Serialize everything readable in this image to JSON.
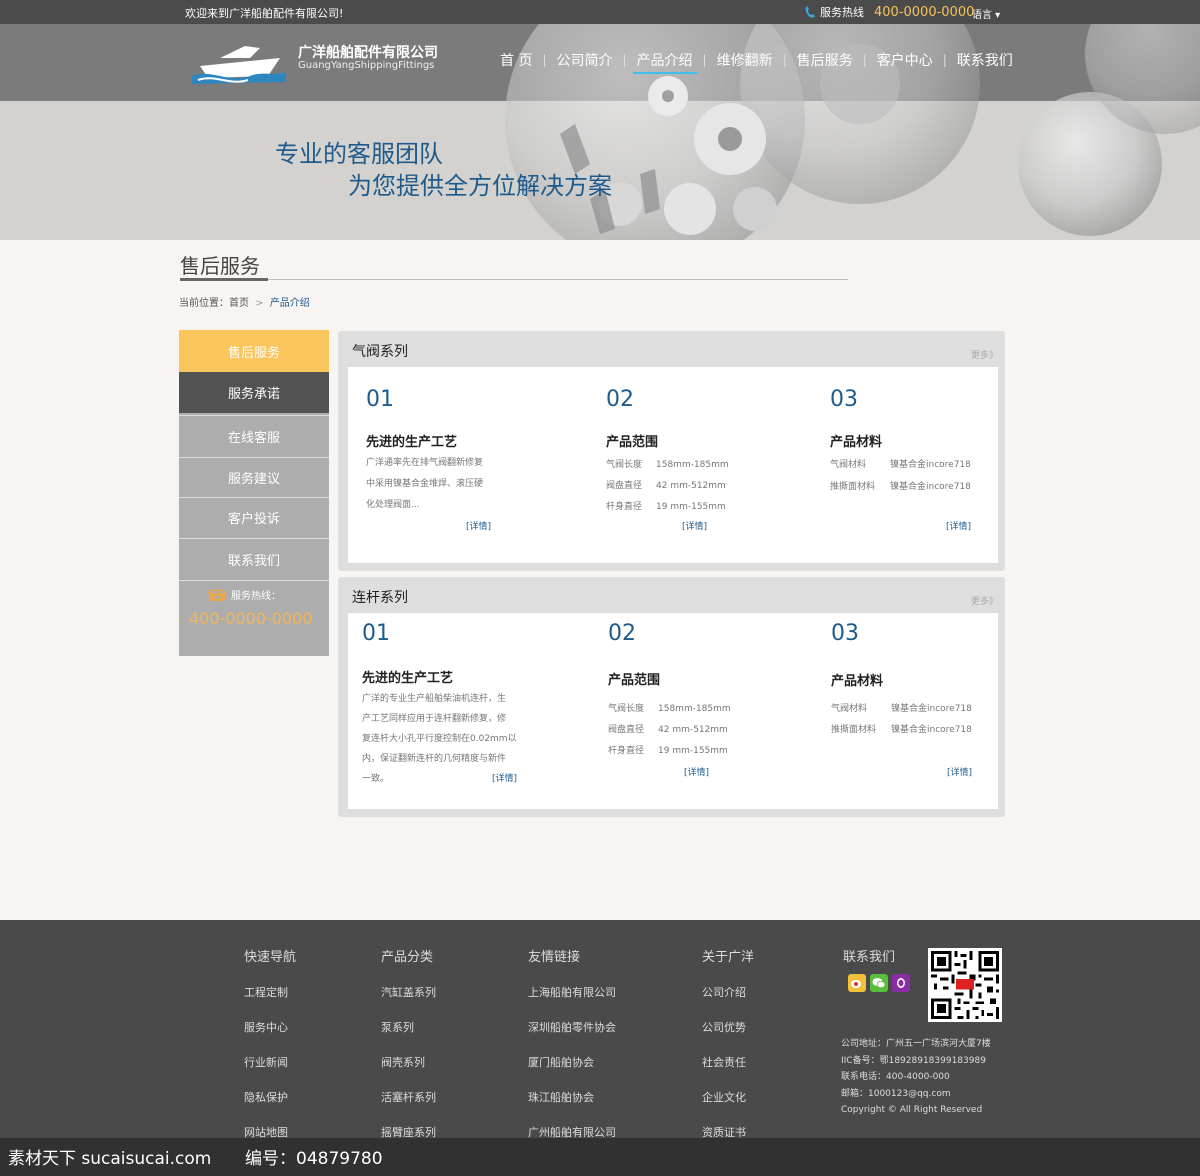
{
  "topbar": {
    "welcome": "欢迎来到广洋船舶配件有限公司!",
    "hotline_label": "服务热线",
    "hotline_number": "400-0000-0000",
    "language": "语言 ▾"
  },
  "logo": {
    "name_cn": "广洋船舶配件有限公司",
    "name_en": "GuangYangShippingFittings"
  },
  "nav": {
    "items": [
      {
        "label": "首 页"
      },
      {
        "label": "公司简介"
      },
      {
        "label": "产品介绍"
      },
      {
        "label": "维修翻新"
      },
      {
        "label": "售后服务"
      },
      {
        "label": "客户中心"
      },
      {
        "label": "联系我们"
      }
    ],
    "separator": "|",
    "active_index": 2
  },
  "banner": {
    "line1": "专业的客服团队",
    "line2": "为您提供全方位解决方案"
  },
  "page": {
    "title": "售后服务",
    "breadcrumb_label": "当前位置：",
    "breadcrumb_home": "首页",
    "breadcrumb_arrow": ">",
    "breadcrumb_current": "产品介绍"
  },
  "sidebar": {
    "items": [
      {
        "label": "售后服务"
      },
      {
        "label": "服务承诺"
      },
      {
        "label": "在线客服"
      },
      {
        "label": "服务建议"
      },
      {
        "label": "客户投诉"
      },
      {
        "label": "联系我们"
      }
    ],
    "hotline_label": "服务热线：",
    "hotline_number": "400-0000-0000"
  },
  "panels": [
    {
      "title": "气阀系列",
      "more": "更多》",
      "cols": [
        {
          "num": "01",
          "heading": "先进的生产工艺",
          "text": [
            "广洋通率先在排气阀翻新修复",
            "中采用镍基合金堆焊、滚压硬",
            "化处理阀面..."
          ],
          "detail": "[详情]"
        },
        {
          "num": "02",
          "heading": "产品范围",
          "rows": [
            [
              "气阀长度",
              "158mm-185mm"
            ],
            [
              "阀盘直径",
              "42 mm-512mm"
            ],
            [
              "杆身直径",
              "19 mm-155mm"
            ]
          ],
          "detail": "[详情]"
        },
        {
          "num": "03",
          "heading": "产品材料",
          "rows": [
            [
              "气阀材料",
              "镍基合金incore718"
            ],
            [
              "推撕面材料",
              "镍基合金incore718"
            ]
          ],
          "detail": "[详情]"
        }
      ]
    },
    {
      "title": "连杆系列",
      "more": "更多》",
      "cols": [
        {
          "num": "01",
          "heading": "先进的生产工艺",
          "text": [
            "广洋的专业生产船舶柴油机连杆，生",
            "产工艺同样应用于连杆翻新修复，修",
            "复连杆大小孔平行度控制在0.02mm以",
            "内，保证翻新连杆的几何精度与新件",
            "一致。"
          ],
          "detail": "[详情]"
        },
        {
          "num": "02",
          "heading": "产品范围",
          "rows": [
            [
              "气阀长度",
              "158mm-185mm"
            ],
            [
              "阀盘直径",
              "42 mm-512mm"
            ],
            [
              "杆身直径",
              "19 mm-155mm"
            ]
          ],
          "detail": "[详情]"
        },
        {
          "num": "03",
          "heading": "产品材料",
          "rows": [
            [
              "气阀材料",
              "镍基合金incore718"
            ],
            [
              "推撕面材料",
              "镍基合金incore718"
            ]
          ],
          "detail": "[详情]"
        }
      ]
    }
  ],
  "footer": {
    "columns": [
      {
        "heading": "快速导航",
        "links": [
          "工程定制",
          "服务中心",
          "行业新闻",
          "隐私保护",
          "网站地图"
        ]
      },
      {
        "heading": "产品分类",
        "links": [
          "汽缸盖系列",
          "泵系列",
          "阀壳系列",
          "活塞杆系列",
          "摇臂座系列"
        ]
      },
      {
        "heading": "友情链接",
        "links": [
          "上海船舶有限公司",
          "深圳船舶零件协会",
          "厦门船舶协会",
          "珠江船舶协会",
          "广州船舶有限公司"
        ]
      },
      {
        "heading": "关于广洋",
        "links": [
          "公司介绍",
          "公司优势",
          "社会责任",
          "企业文化",
          "资质证书"
        ]
      }
    ],
    "contact_heading": "联系我们",
    "info": [
      "公司地址：广州五一广场滨河大厦7楼",
      "IIC备号：鄂18928918399183989",
      "联系电话：400-4000-000",
      "邮箱：1000123@qq.com",
      "Copyright ©  All Right Reserved"
    ],
    "social_icons": [
      "weibo-icon",
      "wechat-icon",
      "qq-icon"
    ]
  },
  "watermark": {
    "left": "素材天下 sucaisucai.com",
    "right": "编号：04879780"
  }
}
